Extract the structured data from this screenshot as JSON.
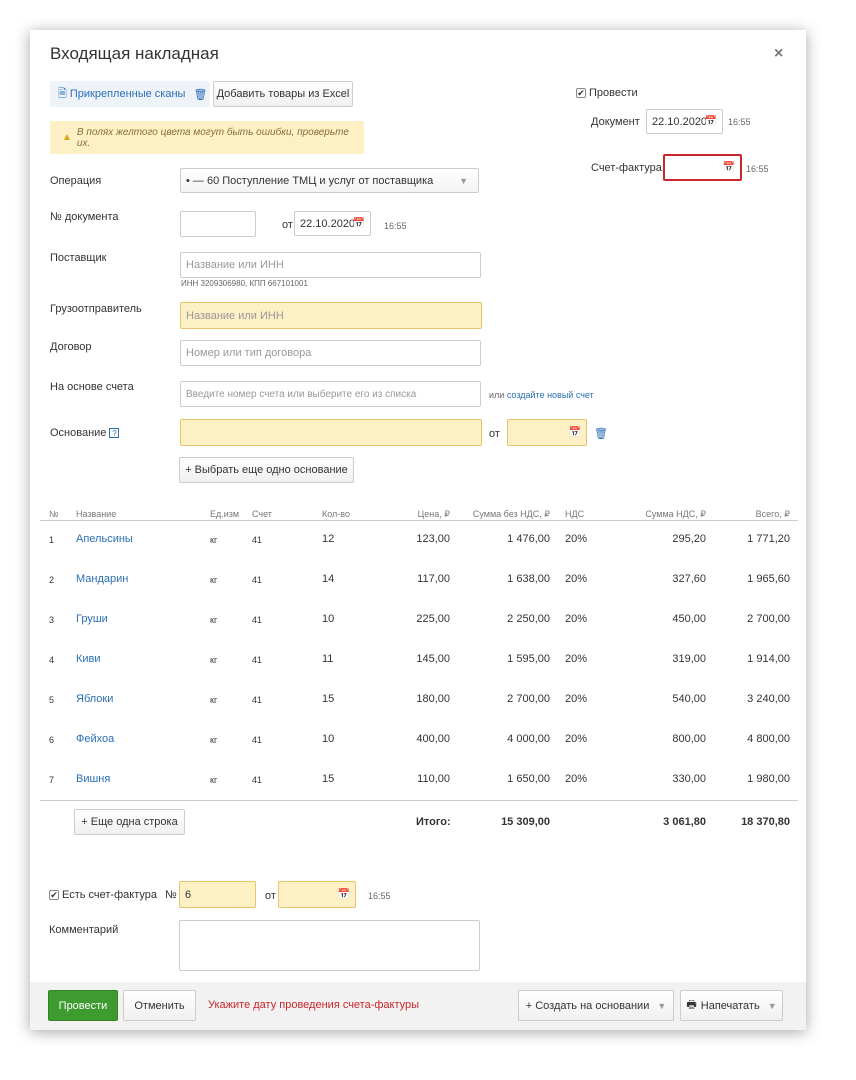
{
  "dialog": {
    "title": "Входящая накладная",
    "close": "×"
  },
  "top": {
    "scans": "Прикрепленные сканы",
    "excel_btn": "Добавить товары из Excel",
    "provesti_chk": "Провести",
    "doc_label": "Документ",
    "doc_date": "22.10.2020",
    "doc_time": "16:55",
    "sf_label": "Счет-фактура",
    "sf_time": "16:55",
    "warning": "В полях желтого цвета могут быть ошибки, проверьте их."
  },
  "form": {
    "operation_label": "Операция",
    "operation_value": "• — 60 Поступление ТМЦ и услуг от поставщика",
    "docnum_label": "№ документа",
    "docnum_value": "",
    "ot": "от",
    "docnum_date": "22.10.2020",
    "docnum_time": "16:55",
    "supplier_label": "Поставщик",
    "supplier_placeholder": "Название или ИНН",
    "supplier_sub": "ИНН 3209306980, КПП 667101001",
    "shipper_label": "Грузоотправитель",
    "shipper_placeholder": "Название или ИНН",
    "contract_label": "Договор",
    "contract_placeholder": "Номер или тип договора",
    "invoice_label": "На основе счета",
    "invoice_placeholder": "Введите номер счета или выберите его из списка",
    "or_text": "или",
    "create_invoice_link": "создайте новый счет",
    "basis_label": "Основание",
    "basis_help": "?",
    "basis_ot": "от",
    "add_basis_btn": "+ Выбрать еще одно основание"
  },
  "table": {
    "headers": [
      "№",
      "Название",
      "Ед.изм",
      "Счет",
      "Кол-во",
      "Цена, ₽",
      "Сумма без НДС, ₽",
      "НДС",
      "Сумма НДС, ₽",
      "Всего, ₽"
    ],
    "rows": [
      [
        "1",
        "Апельсины",
        "кг",
        "41",
        "12",
        "123,00",
        "1 476,00",
        "20%",
        "295,20",
        "1 771,20"
      ],
      [
        "2",
        "Мандарин",
        "кг",
        "41",
        "14",
        "117,00",
        "1 638,00",
        "20%",
        "327,60",
        "1 965,60"
      ],
      [
        "3",
        "Груши",
        "кг",
        "41",
        "10",
        "225,00",
        "2 250,00",
        "20%",
        "450,00",
        "2 700,00"
      ],
      [
        "4",
        "Киви",
        "кг",
        "41",
        "11",
        "145,00",
        "1 595,00",
        "20%",
        "319,00",
        "1 914,00"
      ],
      [
        "5",
        "Яблоки",
        "кг",
        "41",
        "15",
        "180,00",
        "2 700,00",
        "20%",
        "540,00",
        "3 240,00"
      ],
      [
        "6",
        "Фейхоа",
        "кг",
        "41",
        "10",
        "400,00",
        "4 000,00",
        "20%",
        "800,00",
        "4 800,00"
      ],
      [
        "7",
        "Вишня",
        "кг",
        "41",
        "15",
        "110,00",
        "1 650,00",
        "20%",
        "330,00",
        "1 980,00"
      ]
    ],
    "add_row_btn": "+ Еще одна строка",
    "total_label": "Итого:",
    "total_sum": "15 309,00",
    "total_vat": "3 061,80",
    "total_all": "18 370,80"
  },
  "bottom": {
    "sf_chk": "Есть счет-фактура",
    "sf_num_label": "№",
    "sf_num": "6",
    "sf_ot": "от",
    "sf_time": "16:55",
    "comment_label": "Комментарий"
  },
  "footer": {
    "provesti": "Провести",
    "cancel": "Отменить",
    "error": "Укажите дату проведения счета-фактуры",
    "create_basis": "+ Создать на основании",
    "print": "Напечатать"
  },
  "colors": {
    "green": "#3e9b2f",
    "yellow": "#fdf0c4",
    "error": "#c9262d",
    "link": "#2a6fb6"
  }
}
